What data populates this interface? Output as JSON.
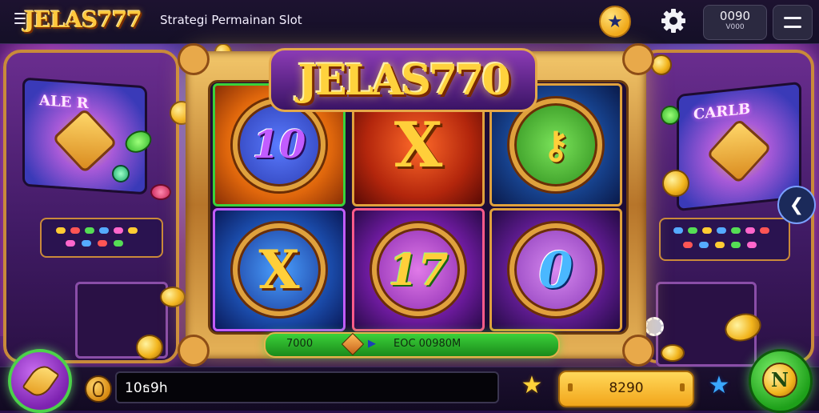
{
  "header": {
    "logo": "JELAS777",
    "subtitle": "Strategi Permainan Slot",
    "counter_value": "0090",
    "counter_sub": "V000"
  },
  "game": {
    "title": "JELAS770",
    "symbols": [
      "10",
      "X",
      "",
      "X",
      "17",
      "0"
    ],
    "paybar_left": "7000",
    "paybar_right": "EOC 00980M"
  },
  "arcade": {
    "left_screen_text": "ALE R",
    "right_screen_text": "CARLB"
  },
  "footer": {
    "input_value": "10ธ9h",
    "balance": "8290"
  },
  "icons": {
    "menu": "menu-icon",
    "star": "star-icon",
    "settings": "gear-icon",
    "hamburger": "hamburger-icon",
    "back": "chevron-left-icon",
    "spin": "spin-icon"
  },
  "colors": {
    "accent_gold": "#ffc83d",
    "accent_green": "#3bd13a",
    "accent_purple": "#8a3cc9"
  }
}
